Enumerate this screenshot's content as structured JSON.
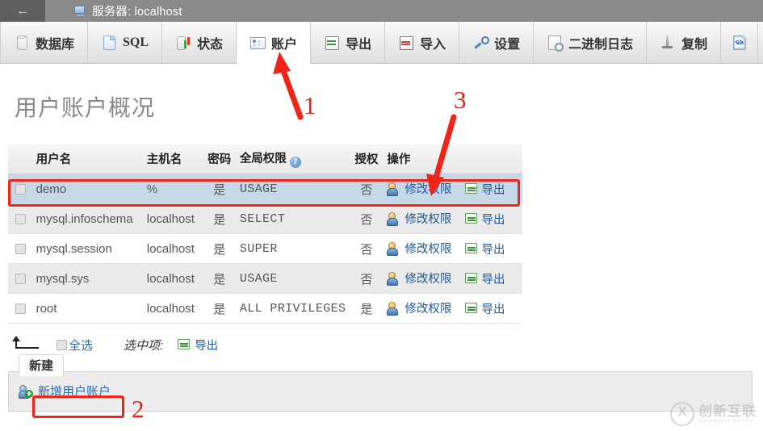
{
  "window": {
    "back_icon": "back-arrow-icon",
    "server_icon": "server-icon",
    "title": "服务器: localhost"
  },
  "tabs": [
    {
      "label": "数据库",
      "icon": "database-icon",
      "active": false
    },
    {
      "label": "SQL",
      "icon": "sql-document-icon",
      "active": false
    },
    {
      "label": "状态",
      "icon": "status-chart-icon",
      "active": false
    },
    {
      "label": "账户",
      "icon": "user-accounts-icon",
      "active": true
    },
    {
      "label": "导出",
      "icon": "export-icon",
      "active": false
    },
    {
      "label": "导入",
      "icon": "import-icon",
      "active": false
    },
    {
      "label": "设置",
      "icon": "wrench-settings-icon",
      "active": false
    },
    {
      "label": "二进制日志",
      "icon": "binary-log-icon",
      "active": false
    },
    {
      "label": "复制",
      "icon": "replication-icon",
      "active": false
    },
    {
      "label": "",
      "icon": "variables-code-icon",
      "active": false
    }
  ],
  "page": {
    "title": "用户账户概况"
  },
  "table": {
    "headers": {
      "checkbox": "",
      "user": "用户名",
      "host": "主机名",
      "password": "密码",
      "privileges": "全局权限",
      "help_icon": "help-circle-icon",
      "grant": "授权",
      "action": "操作"
    },
    "rows": [
      {
        "user": "demo",
        "host": "%",
        "password": "是",
        "privileges": "USAGE",
        "grant": "否",
        "edit_label": "修改权限",
        "export_label": "导出",
        "highlighted": true
      },
      {
        "user": "mysql.infoschema",
        "host": "localhost",
        "password": "是",
        "privileges": "SELECT",
        "grant": "否",
        "edit_label": "修改权限",
        "export_label": "导出",
        "highlighted": false
      },
      {
        "user": "mysql.session",
        "host": "localhost",
        "password": "是",
        "privileges": "SUPER",
        "grant": "否",
        "edit_label": "修改权限",
        "export_label": "导出",
        "highlighted": false
      },
      {
        "user": "mysql.sys",
        "host": "localhost",
        "password": "是",
        "privileges": "USAGE",
        "grant": "否",
        "edit_label": "修改权限",
        "export_label": "导出",
        "highlighted": false
      },
      {
        "user": "root",
        "host": "localhost",
        "password": "是",
        "privileges": "ALL PRIVILEGES",
        "grant": "是",
        "edit_label": "修改权限",
        "export_label": "导出",
        "highlighted": false
      }
    ]
  },
  "bottom_bar": {
    "with_selected_arrow_icon": "with-selected-arrow-icon",
    "select_all_label": "全选",
    "selected_label": "选中项:",
    "export_label": "导出",
    "export_icon": "export-icon"
  },
  "new_panel": {
    "tab_label": "新建",
    "add_user_label": "新增用户账户",
    "add_user_icon": "add-user-icon"
  },
  "annotations": [
    {
      "number": "1",
      "target": "账户 tab"
    },
    {
      "number": "2",
      "target": "新增用户账户 link"
    },
    {
      "number": "3",
      "target": "demo 行 修改权限"
    }
  ],
  "watermark": {
    "cn": "创新互联",
    "en": "CHUANGXIN HULIAN"
  },
  "colors": {
    "accent_link": "#2a6aa8",
    "annotation_red": "#ee2418",
    "header_bar": "#8a8a8a",
    "row_marked": "#c6d8e8"
  }
}
